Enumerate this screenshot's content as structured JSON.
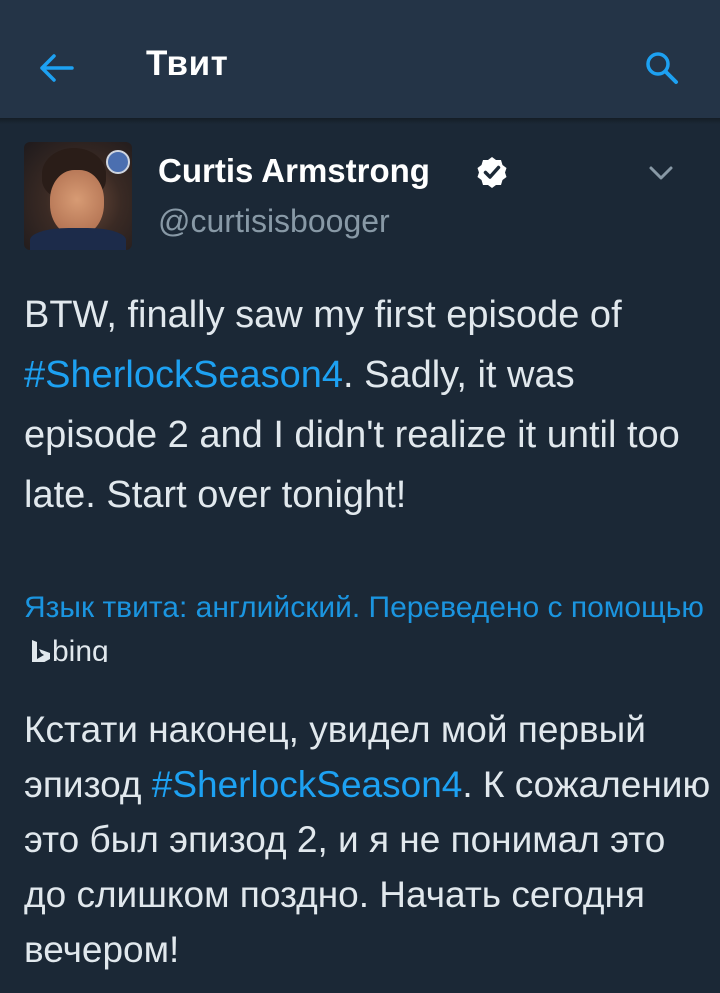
{
  "header": {
    "title": "Твит",
    "back_icon": "arrow-left-icon",
    "search_icon": "search-icon",
    "accent_color": "#1da1f2",
    "background_color": "#243447"
  },
  "tweet": {
    "author_name": "Curtis Armstrong",
    "author_handle": "@curtisisbooger",
    "verified": true,
    "text_parts": {
      "before": "BTW, finally saw my first episode of ",
      "hashtag": "#SherlockSeason4",
      "after": ". Sadly, it was episode 2 and I didn't realize it until too late. Start over tonight!"
    }
  },
  "translation": {
    "note": "Язык твита: английский. Переведено с помощью",
    "provider": "bing",
    "text_parts": {
      "before": "Кстати наконец, увидел мой первый эпизод ",
      "hashtag": "#SherlockSeason4",
      "after": ". К сожалению это был эпизод 2, и я не понимал это до слишком поздно. Начать сегодня вечером!"
    }
  }
}
